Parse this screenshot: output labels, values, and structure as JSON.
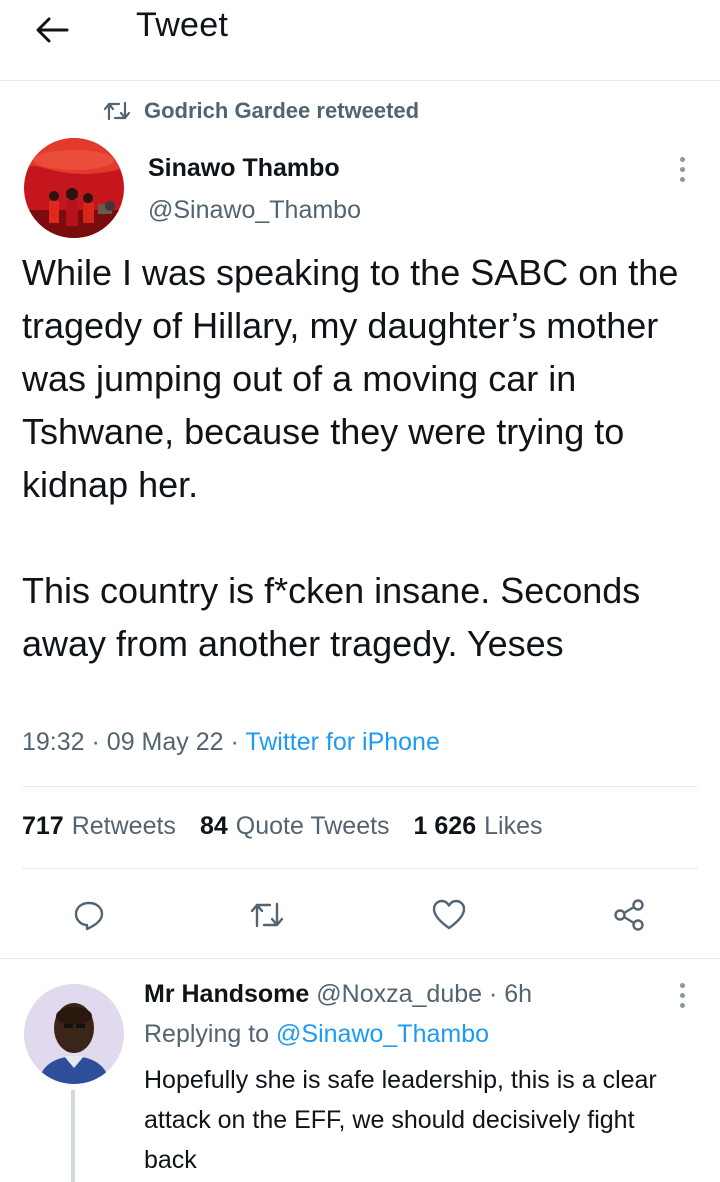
{
  "header": {
    "title": "Tweet"
  },
  "retweet_context": {
    "text": "Godrich Gardee retweeted"
  },
  "tweet": {
    "author_name": "Sinawo Thambo",
    "author_handle": "@Sinawo_Thambo",
    "text": "While I was speaking to the SABC on the tragedy of Hillary, my daughter’s mother was jumping out of a moving car in Tshwane, because they were trying to kidnap her.\n\nThis country is f*cken insane. Seconds away from another tragedy. Yeses",
    "time": "19:32",
    "date": "09 May 22",
    "separator": "·",
    "source": "Twitter for iPhone",
    "stats": {
      "retweets_count": "717",
      "retweets_label": "Retweets",
      "quotes_count": "84",
      "quotes_label": "Quote Tweets",
      "likes_count": "1 626",
      "likes_label": "Likes"
    }
  },
  "reply": {
    "author_name": "Mr Handsome",
    "author_handle": "@Noxza_dube",
    "separator": "·",
    "age": "6h",
    "replying_prefix": "Replying to",
    "replying_handle": "@Sinawo_Thambo",
    "text": "Hopefully she is safe leadership, this is a clear attack on the EFF, we should decisively fight back"
  },
  "icons": {
    "back": "arrow-left-icon",
    "retweet_context": "retweet-icon",
    "more": "more-vertical-icon",
    "reply": "comment-icon",
    "retweet": "retweet-icon",
    "like": "heart-icon",
    "share": "share-icon"
  },
  "colors": {
    "link": "#1d9bf0",
    "secondary_text": "#536471",
    "primary_text": "#0f1419",
    "divider": "#e6ecf0"
  }
}
